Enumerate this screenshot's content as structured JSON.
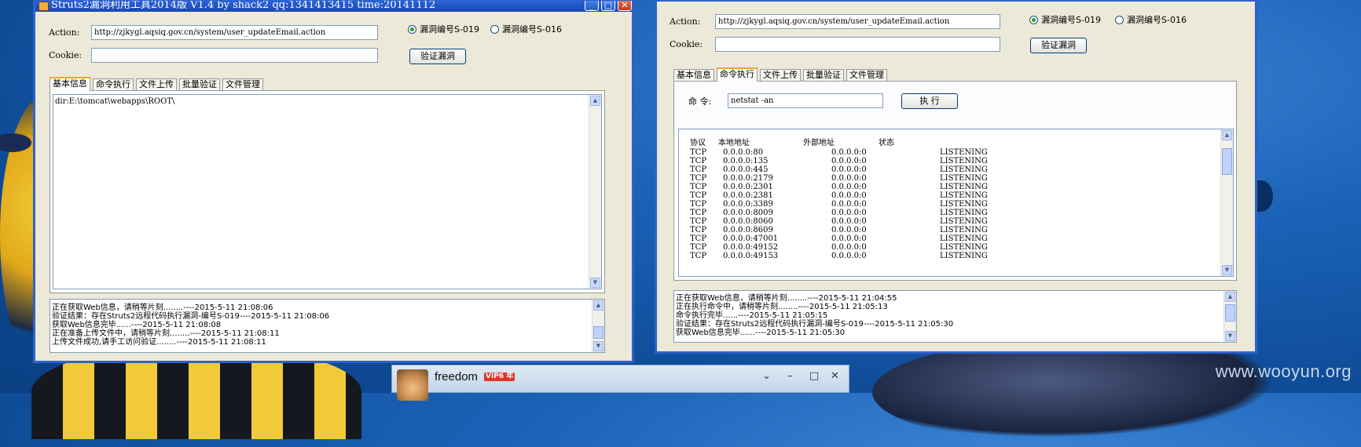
{
  "desktop": {
    "watermark": "www.wooyun.org"
  },
  "left_window": {
    "title": "Struts2漏洞利用工具2014版 V1.4 by shack2 qq:1341413415 time:20141112",
    "action_label": "Action:",
    "action_value": "http://zjkygl.aqsiq.gov.cn/system/user_updateEmail.action",
    "cookie_label": "Cookie:",
    "cookie_value": "",
    "radio_1": "漏洞编号S-019",
    "radio_2": "漏洞编号S-016",
    "verify_button": "验证漏洞",
    "tabs": [
      "基本信息",
      "命令执行",
      "文件上传",
      "批量验证",
      "文件管理"
    ],
    "info_text": "dir:E:\\tomcat\\webapps\\ROOT\\",
    "log": [
      "正在获取Web信息，请稍等片刻........----2015-5-11 21:08:06",
      "验证结果：存在Struts2远程代码执行漏洞-编号S-019----2015-5-11 21:08:06",
      "获取Web信息完毕......----2015-5-11 21:08:08",
      "正在准备上传文件中，请稍等片刻........----2015-5-11 21:08:11",
      "上传文件成功,请手工访问验证........----2015-5-11 21:08:11"
    ]
  },
  "right_window": {
    "action_label": "Action:",
    "action_value": "http://zjkygl.aqsiq.gov.cn/system/user_updateEmail.action",
    "cookie_label": "Cookie:",
    "cookie_value": "",
    "radio_1": "漏洞编号S-019",
    "radio_2": "漏洞编号S-016",
    "verify_button": "验证漏洞",
    "tabs": [
      "基本信息",
      "命令执行",
      "文件上传",
      "批量验证",
      "文件管理"
    ],
    "command_label": "命 令:",
    "command_value": "netstat -an",
    "execute_button": "执 行",
    "netstat_header": [
      "协议",
      "本地地址",
      "外部地址",
      "状态"
    ],
    "netstat_rows": [
      [
        "TCP",
        "0.0.0.0:80",
        "0.0.0.0:0",
        "LISTENING"
      ],
      [
        "TCP",
        "0.0.0.0:135",
        "0.0.0.0:0",
        "LISTENING"
      ],
      [
        "TCP",
        "0.0.0.0:445",
        "0.0.0.0:0",
        "LISTENING"
      ],
      [
        "TCP",
        "0.0.0.0:2179",
        "0.0.0.0:0",
        "LISTENING"
      ],
      [
        "TCP",
        "0.0.0.0:2301",
        "0.0.0.0:0",
        "LISTENING"
      ],
      [
        "TCP",
        "0.0.0.0:2381",
        "0.0.0.0:0",
        "LISTENING"
      ],
      [
        "TCP",
        "0.0.0.0:3389",
        "0.0.0.0:0",
        "LISTENING"
      ],
      [
        "TCP",
        "0.0.0.0:8009",
        "0.0.0.0:0",
        "LISTENING"
      ],
      [
        "TCP",
        "0.0.0.0:8060",
        "0.0.0.0:0",
        "LISTENING"
      ],
      [
        "TCP",
        "0.0.0.0:8609",
        "0.0.0.0:0",
        "LISTENING"
      ],
      [
        "TCP",
        "0.0.0.0:47001",
        "0.0.0.0:0",
        "LISTENING"
      ],
      [
        "TCP",
        "0.0.0.0:49152",
        "0.0.0.0:0",
        "LISTENING"
      ],
      [
        "TCP",
        "0.0.0.0:49153",
        "0.0.0.0:0",
        "LISTENING"
      ]
    ],
    "log": [
      "正在获取Web信息，请稍等片刻........----2015-5-11 21:04:55",
      "正在执行命令中，请稍等片刻........----2015-5-11 21:05:13",
      "命令执行完毕......----2015-5-11 21:05:15",
      "验证结果：存在Struts2远程代码执行漏洞-编号S-019----2015-5-11 21:05:30",
      "获取Web信息完毕......----2015-5-11 21:05:30"
    ]
  },
  "chat": {
    "name": "freedom",
    "badge": "VIP6",
    "badge_suffix": "年"
  }
}
